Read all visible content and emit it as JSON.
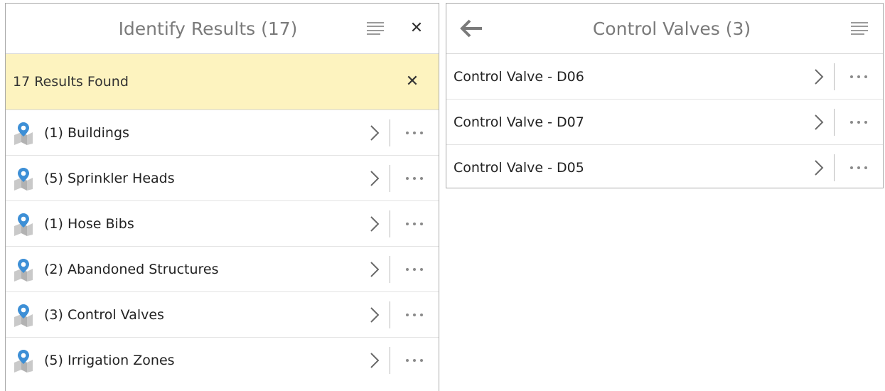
{
  "identify_panel": {
    "title": "Identify Results (17)",
    "banner_text": "17 Results Found",
    "items": [
      {
        "label": "(1) Buildings"
      },
      {
        "label": "(5) Sprinkler Heads"
      },
      {
        "label": "(1) Hose Bibs"
      },
      {
        "label": "(2) Abandoned Structures"
      },
      {
        "label": "(3) Control Valves"
      },
      {
        "label": "(5) Irrigation Zones"
      }
    ]
  },
  "valves_panel": {
    "title": "Control Valves (3)",
    "items": [
      {
        "label": "Control Valve - D06"
      },
      {
        "label": "Control Valve - D07"
      },
      {
        "label": "Control Valve - D05"
      }
    ]
  },
  "icons": {
    "layer": "map-pin-layer-icon",
    "chevron": "chevron-right-icon",
    "more": "more-dots-icon",
    "menu": "menu-icon",
    "close": "close-icon",
    "back": "arrow-left-icon"
  },
  "colors": {
    "banner_bg": "#fdf3bf",
    "pin_blue": "#3d8fd6",
    "title_gray": "#7a7a7a",
    "border": "#a9a9a9"
  }
}
